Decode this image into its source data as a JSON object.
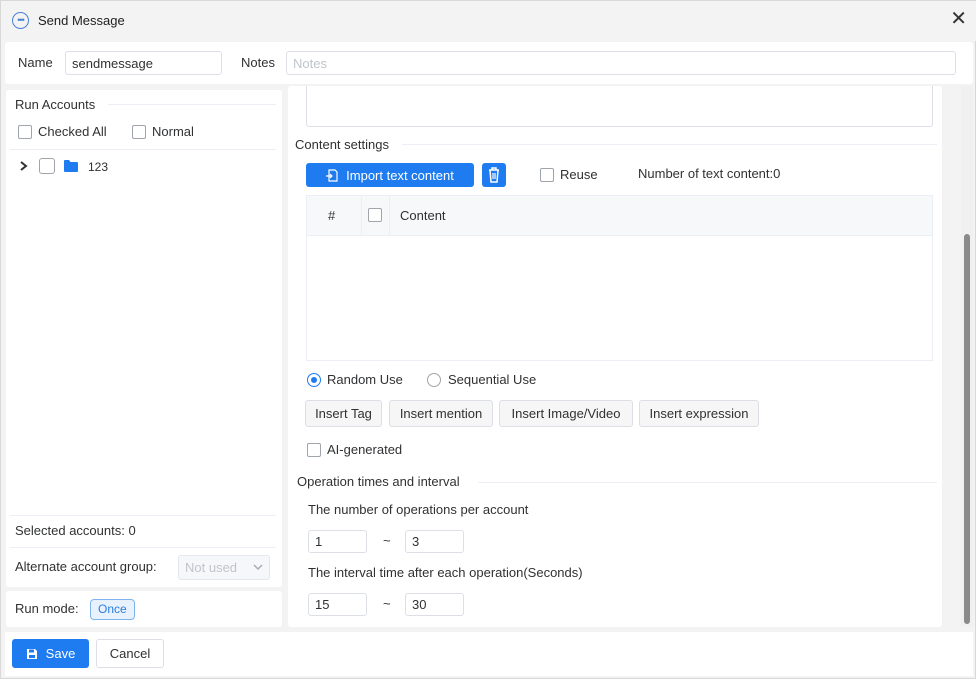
{
  "window": {
    "title": "Send Message",
    "icon": "chat-bubble-icon",
    "close_icon": "close-icon"
  },
  "name_row": {
    "name_label": "Name",
    "name_value": "sendmessage",
    "notes_label": "Notes",
    "notes_placeholder": "Notes"
  },
  "left": {
    "run_accounts_title": "Run Accounts",
    "checked_all_label": "Checked All",
    "normal_label": "Normal",
    "tree": [
      {
        "label": "123",
        "expand_icon": "chevron-right-icon",
        "folder_icon": "folder-icon"
      }
    ],
    "selected_accounts": "Selected accounts: 0",
    "alternate_group_label": "Alternate account group:",
    "alternate_group_value": "Not used",
    "run_mode_label": "Run mode:",
    "run_mode_value": "Once"
  },
  "content": {
    "section_title": "Content settings",
    "import_button": "Import text content",
    "import_icon": "import-file-icon",
    "delete_icon": "trash-icon",
    "reuse_label": "Reuse",
    "count_text": "Number of text content:0",
    "table_headers": [
      "#",
      "Content"
    ],
    "rows": [],
    "random_use_label": "Random Use",
    "sequential_use_label": "Sequential Use",
    "use_mode_selected": "Random Use",
    "insert_buttons": [
      "Insert Tag",
      "Insert mention",
      "Insert Image/Video",
      "Insert expression"
    ],
    "ai_generated_label": "AI-generated"
  },
  "operation": {
    "section_title": "Operation times and interval",
    "ops_label": "The number of operations per account",
    "ops_min": "1",
    "ops_max": "3",
    "interval_label": "The interval time after each operation(Seconds)",
    "interval_min": "15",
    "interval_max": "30",
    "range_separator": "~"
  },
  "footer": {
    "save_label": "Save",
    "save_icon": "save-icon",
    "cancel_label": "Cancel"
  },
  "colors": {
    "primary": "#1e7cf0",
    "tag_border": "#7fb3ee",
    "tag_text": "#2b7de0",
    "folder": "#1e7cf0"
  }
}
